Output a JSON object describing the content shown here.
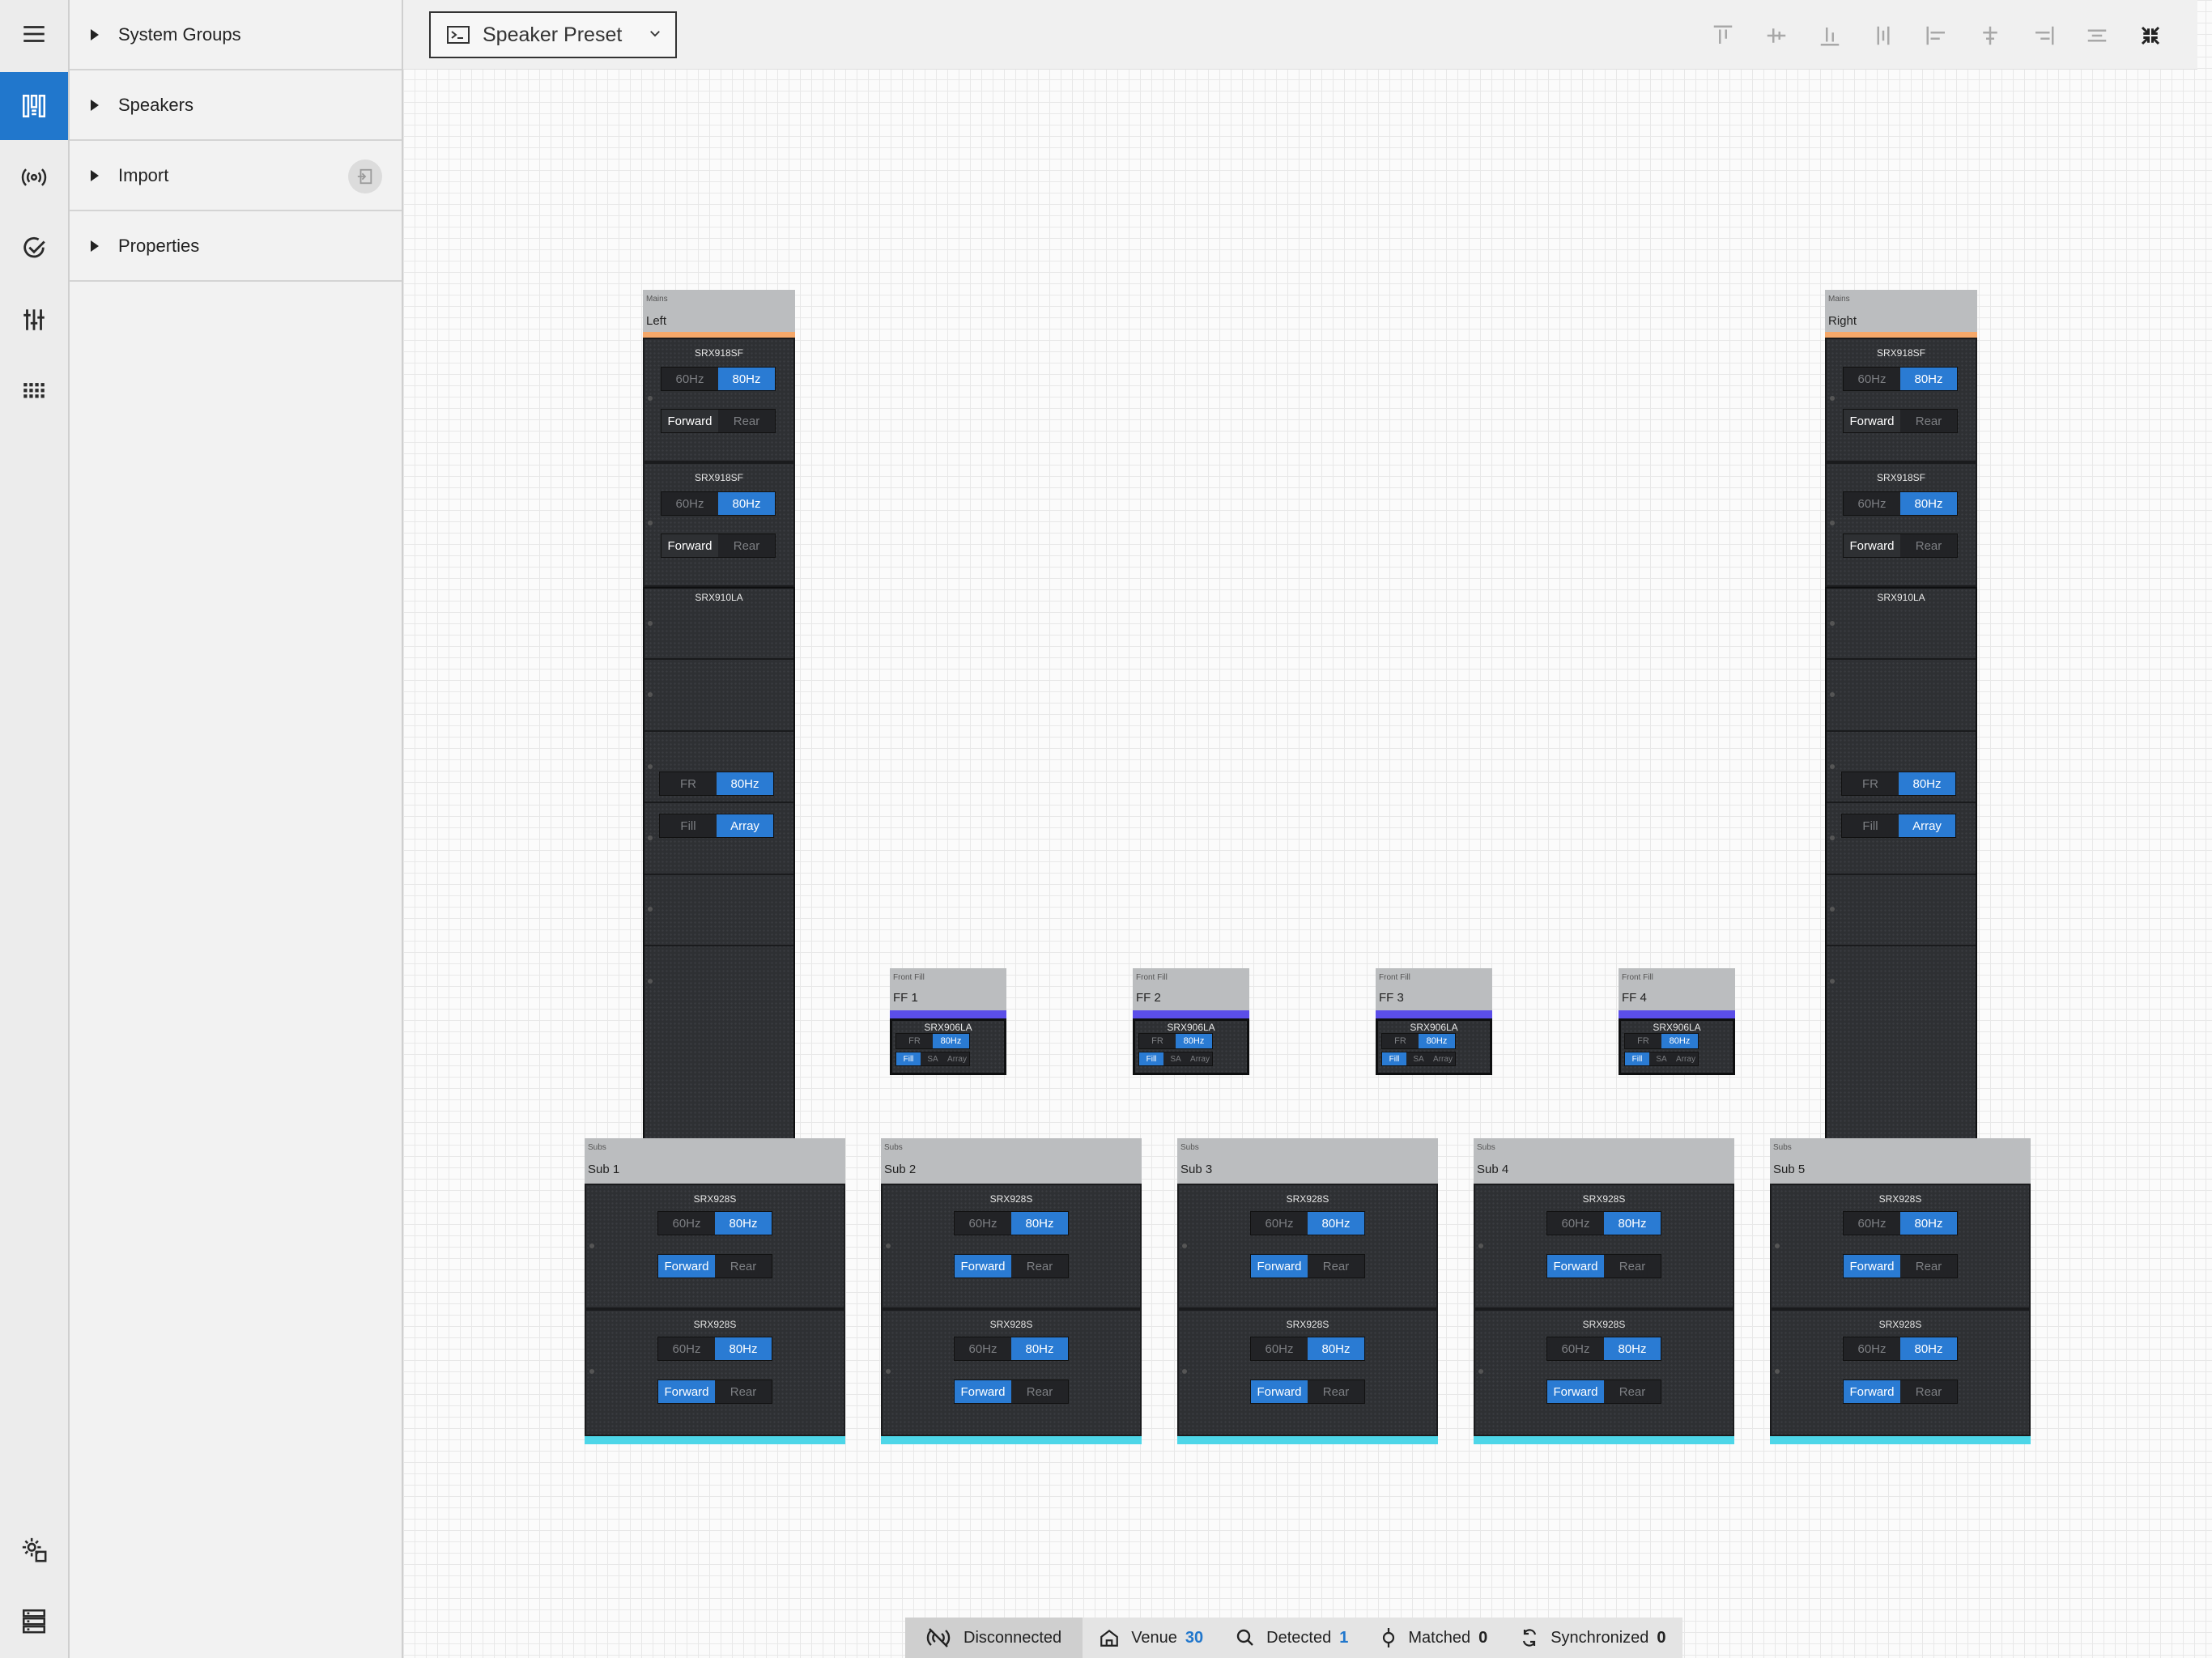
{
  "panel": {
    "sections": [
      {
        "label": "System Groups"
      },
      {
        "label": "Speakers"
      },
      {
        "label": "Import"
      },
      {
        "label": "Properties"
      }
    ]
  },
  "rail": {
    "items": [
      "menu-icon",
      "layout-icon",
      "broadcast-icon",
      "check-circle-icon",
      "sliders-icon",
      "grid-icon",
      "settings-device-icon",
      "server-list-icon"
    ]
  },
  "toolbar": {
    "preset_label": "Speaker Preset"
  },
  "mains": [
    {
      "category": "Mains",
      "name": "Left",
      "top_model": "SRX918SF",
      "sub_model": "SRX918SF",
      "array_model": "SRX910LA",
      "freq": [
        "60Hz",
        "80Hz"
      ],
      "dir": [
        "Forward",
        "Rear"
      ],
      "fr": [
        "FR",
        "80Hz"
      ],
      "fill": [
        "Fill",
        "Array"
      ]
    },
    {
      "category": "Mains",
      "name": "Right",
      "top_model": "SRX918SF",
      "sub_model": "SRX918SF",
      "array_model": "SRX910LA",
      "freq": [
        "60Hz",
        "80Hz"
      ],
      "dir": [
        "Forward",
        "Rear"
      ],
      "fr": [
        "FR",
        "80Hz"
      ],
      "fill": [
        "Fill",
        "Array"
      ]
    }
  ],
  "front_fills": [
    {
      "category": "Front Fill",
      "name": "FF 1",
      "model": "SRX906LA",
      "fr": [
        "FR",
        "80Hz"
      ],
      "mode": [
        "Fill",
        "SA",
        "Array"
      ]
    },
    {
      "category": "Front Fill",
      "name": "FF 2",
      "model": "SRX906LA",
      "fr": [
        "FR",
        "80Hz"
      ],
      "mode": [
        "Fill",
        "SA",
        "Array"
      ]
    },
    {
      "category": "Front Fill",
      "name": "FF 3",
      "model": "SRX906LA",
      "fr": [
        "FR",
        "80Hz"
      ],
      "mode": [
        "Fill",
        "SA",
        "Array"
      ]
    },
    {
      "category": "Front Fill",
      "name": "FF 4",
      "model": "SRX906LA",
      "fr": [
        "FR",
        "80Hz"
      ],
      "mode": [
        "Fill",
        "SA",
        "Array"
      ]
    }
  ],
  "subs": [
    {
      "category": "Subs",
      "name": "Sub 1",
      "model": "SRX928S",
      "freq": [
        "60Hz",
        "80Hz"
      ],
      "dir": [
        "Forward",
        "Rear"
      ]
    },
    {
      "category": "Subs",
      "name": "Sub 2",
      "model": "SRX928S",
      "freq": [
        "60Hz",
        "80Hz"
      ],
      "dir": [
        "Forward",
        "Rear"
      ]
    },
    {
      "category": "Subs",
      "name": "Sub 3",
      "model": "SRX928S",
      "freq": [
        "60Hz",
        "80Hz"
      ],
      "dir": [
        "Forward",
        "Rear"
      ]
    },
    {
      "category": "Subs",
      "name": "Sub 4",
      "model": "SRX928S",
      "freq": [
        "60Hz",
        "80Hz"
      ],
      "dir": [
        "Forward",
        "Rear"
      ]
    },
    {
      "category": "Subs",
      "name": "Sub 5",
      "model": "SRX928S",
      "freq": [
        "60Hz",
        "80Hz"
      ],
      "dir": [
        "Forward",
        "Rear"
      ]
    }
  ],
  "status": {
    "connection": "Disconnected",
    "venue_label": "Venue",
    "venue_count": "30",
    "detected_label": "Detected",
    "detected_count": "1",
    "matched_label": "Matched",
    "matched_count": "0",
    "synchronized_label": "Synchronized",
    "synchronized_count": "0"
  },
  "colors": {
    "accent": "#2177cc",
    "mains_bar": "#f5a86a",
    "frontfill_bar": "#5b4ee8",
    "subs_bar": "#4dd6e8"
  }
}
